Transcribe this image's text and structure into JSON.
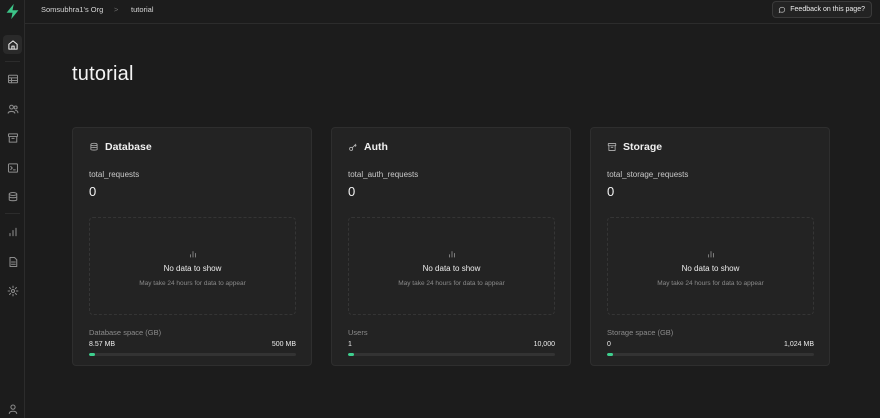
{
  "app": {
    "brand_color": "#3ecf8e"
  },
  "breadcrumb": {
    "org": "Somsubhra1's Org",
    "separator": ">",
    "project": "tutorial"
  },
  "feedback": {
    "label": "Feedback on this page?"
  },
  "sidebar": {
    "items": [
      {
        "icon": "home-icon",
        "active": true
      },
      {
        "icon": "table-editor-icon",
        "active": false
      },
      {
        "icon": "users-icon",
        "active": false
      },
      {
        "icon": "storage-archive-icon",
        "active": false
      },
      {
        "icon": "terminal-icon",
        "active": false
      },
      {
        "icon": "database-icon",
        "active": false
      },
      {
        "icon": "reports-icon",
        "active": false
      },
      {
        "icon": "docs-icon",
        "active": false
      },
      {
        "icon": "settings-icon",
        "active": false
      },
      {
        "icon": "user-profile-icon",
        "active": false
      }
    ]
  },
  "page": {
    "title": "tutorial"
  },
  "cards": [
    {
      "title": "Database",
      "icon": "database-icon",
      "metric_label": "total_requests",
      "metric_value": "0",
      "empty_title": "No data to show",
      "empty_subtitle": "May take 24 hours for data to appear",
      "usage_label": "Database space (GB)",
      "usage_current": "8.57 MB",
      "usage_limit": "500 MB",
      "usage_fraction": 0.03
    },
    {
      "title": "Auth",
      "icon": "key-icon",
      "metric_label": "total_auth_requests",
      "metric_value": "0",
      "empty_title": "No data to show",
      "empty_subtitle": "May take 24 hours for data to appear",
      "usage_label": "Users",
      "usage_current": "1",
      "usage_limit": "10,000",
      "usage_fraction": 0.03
    },
    {
      "title": "Storage",
      "icon": "archive-icon",
      "metric_label": "total_storage_requests",
      "metric_value": "0",
      "empty_title": "No data to show",
      "empty_subtitle": "May take 24 hours for data to appear",
      "usage_label": "Storage space (GB)",
      "usage_current": "0",
      "usage_limit": "1,024 MB",
      "usage_fraction": 0.03
    }
  ]
}
